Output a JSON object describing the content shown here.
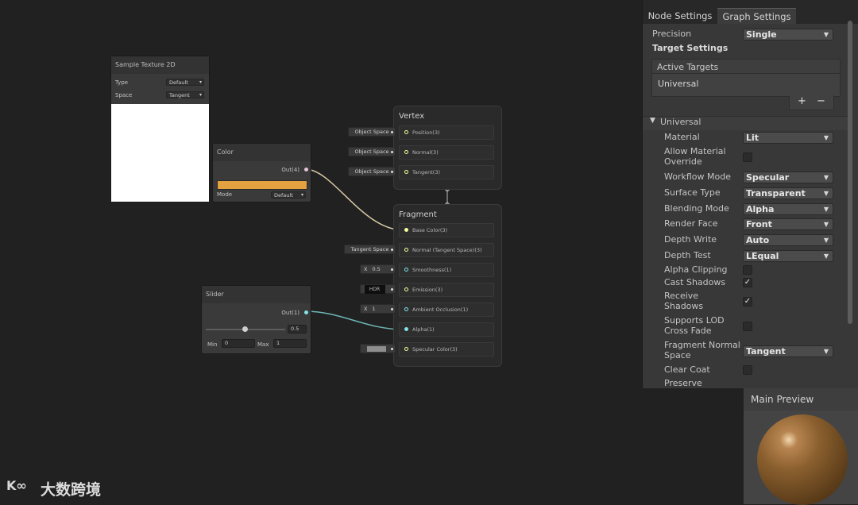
{
  "sample_texture": {
    "title": "Sample Texture 2D",
    "type_label": "Type",
    "type_value": "Default",
    "space_label": "Space",
    "space_value": "Tangent"
  },
  "color_node": {
    "title": "Color",
    "out": "Out(4)",
    "mode_label": "Mode",
    "mode_value": "Default",
    "swatch_color": "#e3a23f"
  },
  "slider_node": {
    "title": "Slider",
    "out": "Out(1)",
    "value": "0.5",
    "slider_fraction": 0.5,
    "min_label": "Min",
    "min_value": "0",
    "max_label": "Max",
    "max_value": "1"
  },
  "vertex_block": {
    "title": "Vertex",
    "ports": [
      {
        "input": "Object Space",
        "label": "Position(3)"
      },
      {
        "input": "Object Space",
        "label": "Normal(3)"
      },
      {
        "input": "Object Space",
        "label": "Tangent(3)"
      }
    ]
  },
  "fragment_block": {
    "title": "Fragment",
    "ports": [
      {
        "label": "Base Color(3)"
      },
      {
        "input": "Tangent Space",
        "label": "Normal (Tangent Space)(3)"
      },
      {
        "x": "X",
        "value": "0.5",
        "label": "Smoothness(1)"
      },
      {
        "hdr": "HDR",
        "label": "Emission(3)"
      },
      {
        "x": "X",
        "value": "1",
        "label": "Ambient Occlusion(1)"
      },
      {
        "label": "Alpha(1)"
      },
      {
        "label": "Specular Color(3)"
      }
    ]
  },
  "inspector": {
    "tabs": [
      "Node Settings",
      "Graph Settings"
    ],
    "precision_label": "Precision",
    "precision_value": "Single",
    "target_settings": "Target Settings",
    "active_targets": "Active Targets",
    "target_item": "Universal",
    "add": "+",
    "remove": "−",
    "section": "Universal",
    "rows": [
      {
        "label": "Material",
        "value": "Lit"
      },
      {
        "label": "Allow Material Override",
        "checked": false
      },
      {
        "label": "Workflow Mode",
        "value": "Specular"
      },
      {
        "label": "Surface Type",
        "value": "Transparent"
      },
      {
        "label": "Blending Mode",
        "value": "Alpha"
      },
      {
        "label": "Render Face",
        "value": "Front"
      },
      {
        "label": "Depth Write",
        "value": "Auto"
      },
      {
        "label": "Depth Test",
        "value": "LEqual"
      },
      {
        "label": "Alpha Clipping",
        "checked": false
      },
      {
        "label": "Cast Shadows",
        "checked": true
      },
      {
        "label": "Receive Shadows",
        "checked": true
      },
      {
        "label": "Supports LOD Cross Fade",
        "checked": false
      },
      {
        "label": "Fragment Normal Space",
        "value": "Tangent"
      },
      {
        "label": "Clear Coat",
        "checked": false
      },
      {
        "label": "Preserve",
        "checked": true
      }
    ]
  },
  "preview": {
    "title": "Main Preview"
  },
  "watermark": {
    "text": "大数跨境"
  },
  "colors": {
    "vector3_port": "#f6ff9a",
    "vector1_port": "#84e4e7",
    "wire_color": "#e8d9a0",
    "wire_alpha": "#84d0d0"
  }
}
